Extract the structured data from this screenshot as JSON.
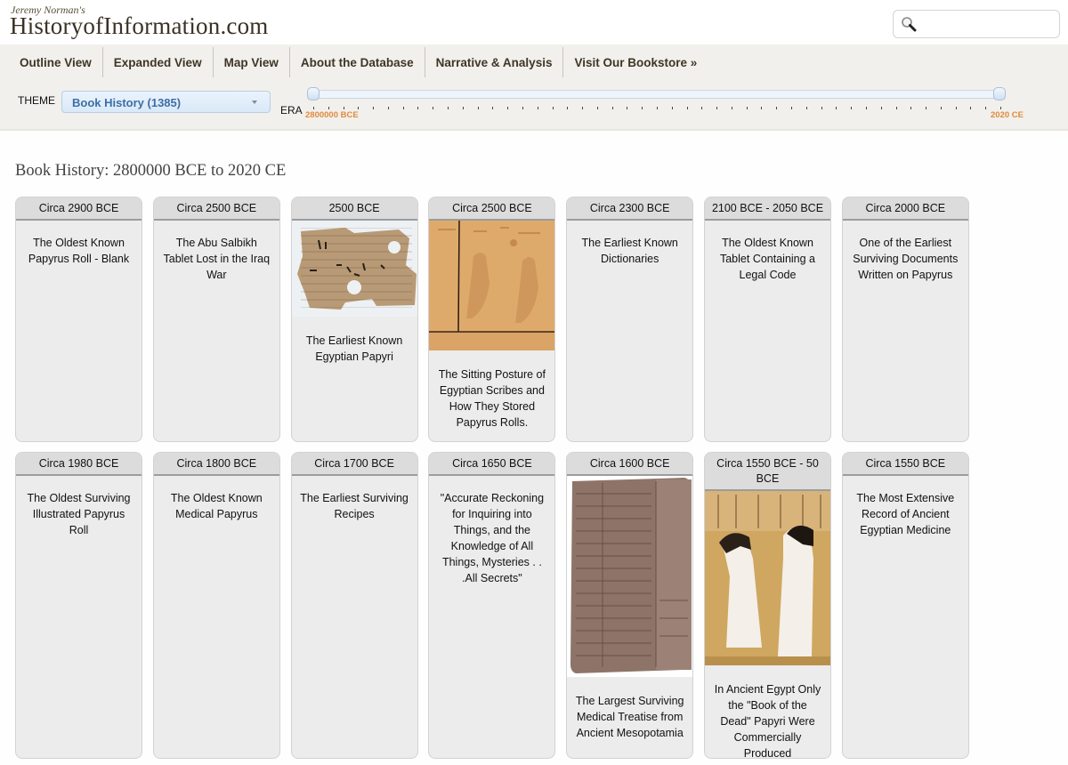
{
  "site": {
    "author": "Jeremy Norman's",
    "name": "HistoryofInformation.com"
  },
  "search": {
    "placeholder": "",
    "value": ""
  },
  "nav": [
    {
      "label": "Outline View"
    },
    {
      "label": "Expanded View"
    },
    {
      "label": "Map View"
    },
    {
      "label": "About the Database"
    },
    {
      "label": "Narrative & Analysis"
    },
    {
      "label": "Visit Our Bookstore »"
    }
  ],
  "filters": {
    "theme_label": "THEME",
    "theme_value": "Book History (1385)",
    "era_label": "ERA",
    "era_min": "2800000 BCE",
    "era_max": "2020 CE",
    "era_range_fraction": [
      0,
      1
    ]
  },
  "page_title": "Book History: 2800000 BCE to 2020 CE",
  "cards": [
    {
      "date": "Circa 2900 BCE",
      "title": "The Oldest Known Papyrus Roll - Blank",
      "image": null
    },
    {
      "date": "Circa 2500 BCE",
      "title": "The Abu Salbikh Tablet Lost in the Iraq War",
      "image": null
    },
    {
      "date": "2500 BCE",
      "title": "The Earliest Known Egyptian Papyri",
      "image": "papyrus-fragment"
    },
    {
      "date": "Circa 2500 BCE",
      "title": "The Sitting Posture of Egyptian Scribes and How They Stored Papyrus Rolls.",
      "image": "scribes-relief"
    },
    {
      "date": "Circa 2300 BCE",
      "title": "The Earliest Known Dictionaries",
      "image": null
    },
    {
      "date": "2100 BCE - 2050 BCE",
      "title": "The Oldest Known Tablet Containing a Legal Code",
      "image": null
    },
    {
      "date": "Circa 2000 BCE",
      "title": "One of the Earliest Surviving Documents Written on Papyrus",
      "image": null
    },
    {
      "date": "Circa 1980 BCE",
      "title": "The Oldest Surviving Illustrated Papyrus Roll",
      "image": null
    },
    {
      "date": "Circa 1800 BCE",
      "title": "The Oldest Known Medical Papyrus",
      "image": null
    },
    {
      "date": "Circa 1700 BCE",
      "title": "The Earliest Surviving Recipes",
      "image": null
    },
    {
      "date": "Circa 1650 BCE",
      "title": "\"Accurate Reckoning for Inquiring into Things, and the Knowledge of All Things, Mysteries . . .All Secrets\"",
      "image": null
    },
    {
      "date": "Circa 1600 BCE",
      "title": "The Largest Surviving Medical Treatise from Ancient Mesopotamia",
      "image": "clay-tablet"
    },
    {
      "date": "Circa 1550 BCE - 50 BCE",
      "title": "In Ancient Egypt Only the \"Book of the Dead\" Papyri Were Commercially Produced",
      "image": "book-of-the-dead"
    },
    {
      "date": "Circa 1550 BCE",
      "title": "The Most Extensive Record of Ancient Egyptian Medicine",
      "image": null
    }
  ]
}
